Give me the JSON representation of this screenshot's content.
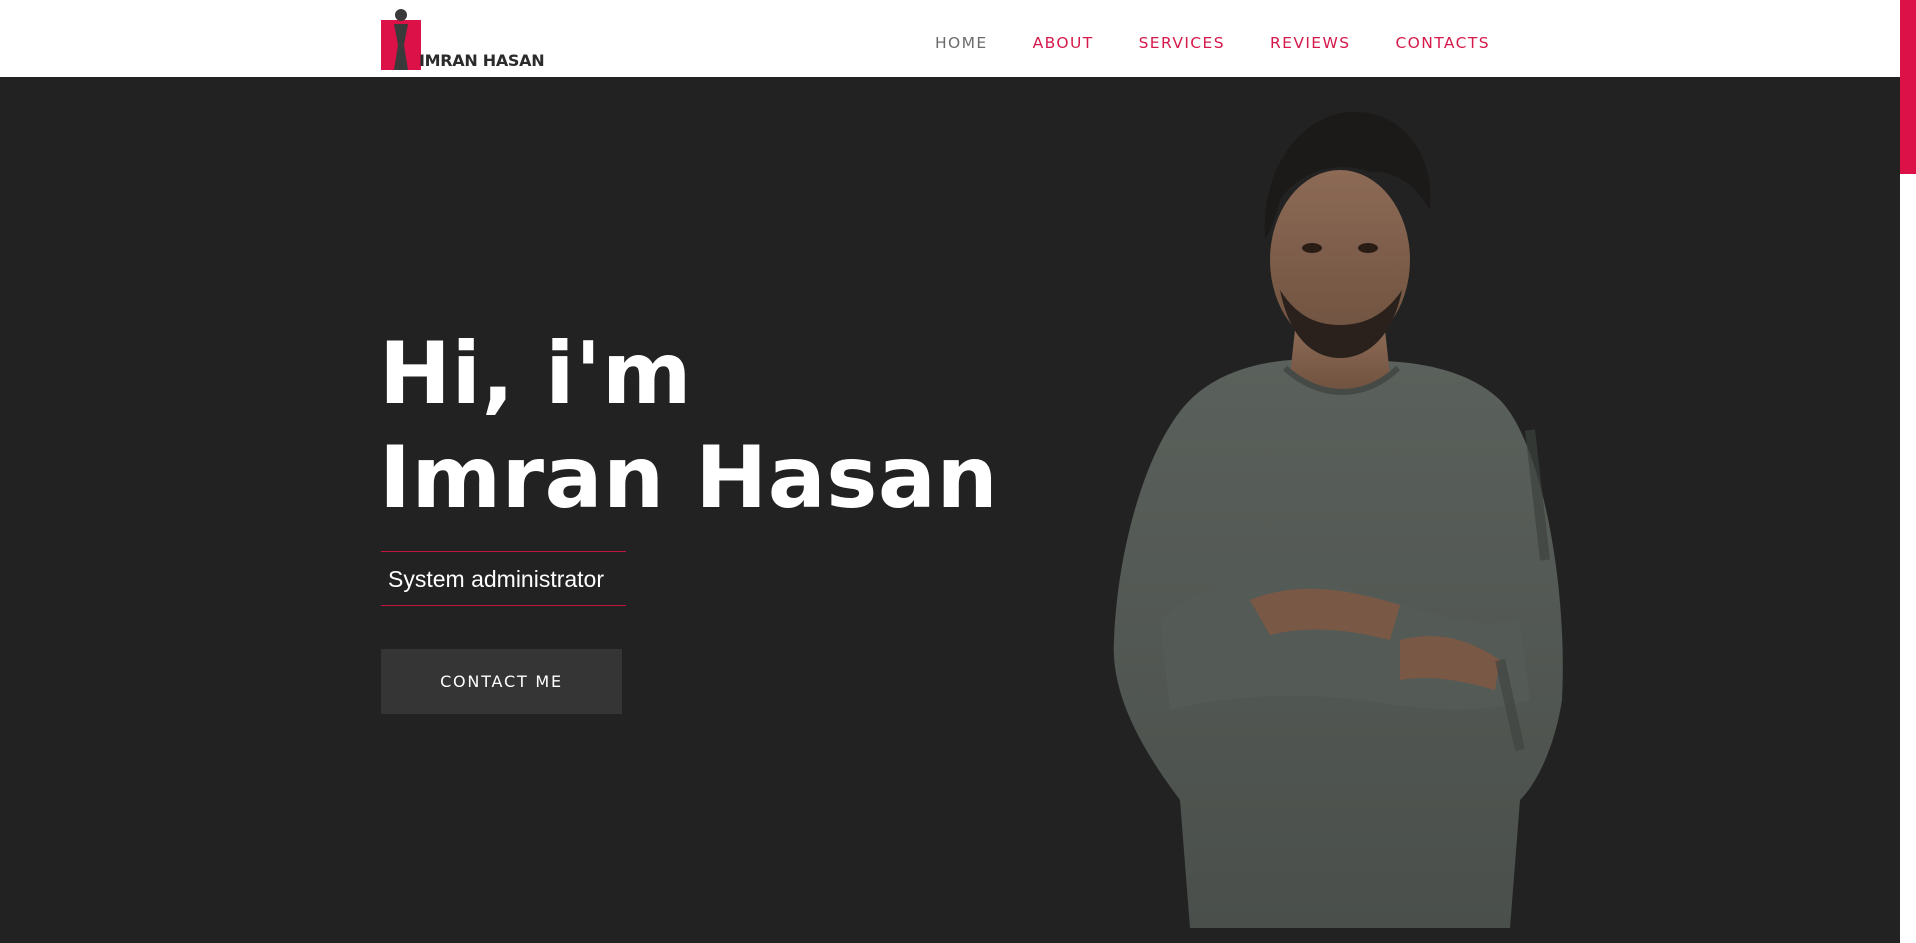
{
  "logo": {
    "text": "IMRAN HASAN",
    "colors": {
      "red": "#dc1148",
      "dark": "#3a3a3a"
    }
  },
  "nav": {
    "items": [
      {
        "label": "HOME",
        "active": true
      },
      {
        "label": "ABOUT",
        "active": false
      },
      {
        "label": "SERVICES",
        "active": false
      },
      {
        "label": "REVIEWS",
        "active": false
      },
      {
        "label": "CONTACTS",
        "active": false
      }
    ]
  },
  "hero": {
    "line1": "Hi, i'm",
    "line2": "Imran Hasan",
    "role": "System administrator",
    "cta_label": "CONTACT ME"
  },
  "colors": {
    "accent": "#dc1148",
    "background": "#222222",
    "button": "#353535",
    "header": "#ffffff"
  },
  "portrait": {
    "icon": "person-photo"
  }
}
